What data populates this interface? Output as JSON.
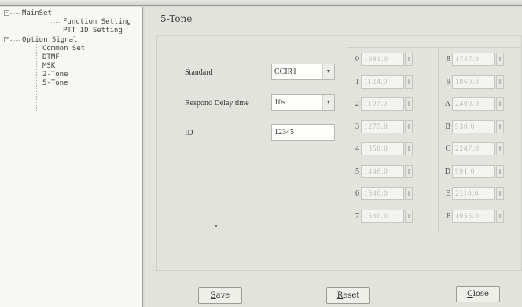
{
  "tree": {
    "items": [
      {
        "label": "MainSet",
        "level": 0,
        "expander": "−"
      },
      {
        "label": "Function Setting",
        "level": 2
      },
      {
        "label": "PTT ID Setting",
        "level": 2
      },
      {
        "label": "Option Signal",
        "level": 0,
        "expander": "−"
      },
      {
        "label": "Common Set",
        "level": 1
      },
      {
        "label": "DTMF",
        "level": 1
      },
      {
        "label": "MSK",
        "level": 1
      },
      {
        "label": "2-Tone",
        "level": 1
      },
      {
        "label": "5-Tone",
        "level": 1
      }
    ]
  },
  "page": {
    "title": "5-Tone"
  },
  "form": {
    "standard_label": "Standard",
    "standard_value": "CCIR1",
    "respond_label": "Respond Delay time",
    "respond_value": "10s",
    "id_label": "ID",
    "id_value": "12345"
  },
  "tones": {
    "left": [
      {
        "key": "0",
        "value": "1981.0"
      },
      {
        "key": "1",
        "value": "1124.0"
      },
      {
        "key": "2",
        "value": "1197.0"
      },
      {
        "key": "3",
        "value": "1275.0"
      },
      {
        "key": "4",
        "value": "1358.0"
      },
      {
        "key": "5",
        "value": "1446.0"
      },
      {
        "key": "6",
        "value": "1540.0"
      },
      {
        "key": "7",
        "value": "1640.0"
      }
    ],
    "right": [
      {
        "key": "8",
        "value": "1747.0"
      },
      {
        "key": "9",
        "value": "1860.0"
      },
      {
        "key": "A",
        "value": "2400.0"
      },
      {
        "key": "B",
        "value": "930.0"
      },
      {
        "key": "C",
        "value": "2247.0"
      },
      {
        "key": "D",
        "value": "991.0"
      },
      {
        "key": "E",
        "value": "2110.0"
      },
      {
        "key": "F",
        "value": "1055.0"
      }
    ]
  },
  "buttons": {
    "save": {
      "mnemonic": "S",
      "rest": "ave"
    },
    "reset": {
      "mnemonic": "R",
      "rest": "eset"
    },
    "close": {
      "mnemonic": "C",
      "rest": "lose"
    }
  },
  "icons": {
    "expand_collapse": "minus-box-icon",
    "dropdown": "chevron-down-icon",
    "spin": "spin-arrows-icon"
  }
}
